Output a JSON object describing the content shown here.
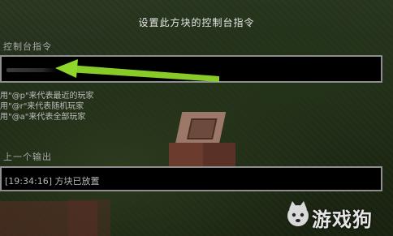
{
  "screen": {
    "title": "设置此方块的控制台指令",
    "command_label": "控制台指令",
    "command_value": "",
    "help_lines": [
      "用\"@p\"来代表最近的玩家",
      "用\"@r\"来代表随机玩家",
      "用\"@a\"来代表全部玩家"
    ],
    "output_label": "上一个输出",
    "output_value": "[19:34:16] 方块已放置"
  },
  "annotation": {
    "arrow_color": "#8fd62a"
  },
  "watermark": {
    "text": "游戏狗"
  }
}
